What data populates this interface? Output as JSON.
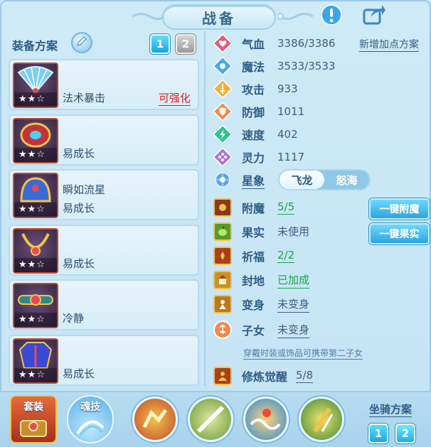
{
  "title": "战备",
  "top_icons": {
    "info": "exclamation-icon",
    "share": "share-icon"
  },
  "left": {
    "section_label": "装备方案",
    "plans": [
      "1",
      "2"
    ],
    "active_plan": 0,
    "equipment": [
      {
        "name": "",
        "attr": "法术暴击",
        "stars": "★★☆",
        "upgrade": "可强化",
        "icon": "fan-icon"
      },
      {
        "name": "",
        "attr": "易成长",
        "stars": "★★☆",
        "upgrade": "",
        "icon": "gem-icon"
      },
      {
        "name": "瞬如流星",
        "attr": "易成长",
        "stars": "★★☆",
        "upgrade": "",
        "icon": "helmet-icon"
      },
      {
        "name": "",
        "attr": "易成长",
        "stars": "★★☆",
        "upgrade": "",
        "icon": "necklace-icon"
      },
      {
        "name": "",
        "attr": "冷静",
        "stars": "★★☆",
        "upgrade": "",
        "icon": "belt-icon"
      },
      {
        "name": "",
        "attr": "易成长",
        "stars": "★★☆",
        "upgrade": "",
        "icon": "armor-icon"
      }
    ]
  },
  "stats": {
    "add_points": "新增加点方案",
    "items": [
      {
        "name": "气血",
        "value": "3386/3386",
        "color": "#e85a7a",
        "icon": "heart-icon"
      },
      {
        "name": "魔法",
        "value": "3533/3533",
        "color": "#4aa8f0",
        "icon": "mana-icon"
      },
      {
        "name": "攻击",
        "value": "933",
        "color": "#f2b13a",
        "icon": "sword-icon"
      },
      {
        "name": "防御",
        "value": "1011",
        "color": "#f08a4a",
        "icon": "shield-icon"
      },
      {
        "name": "速度",
        "value": "402",
        "color": "#2ec48a",
        "icon": "speed-icon"
      },
      {
        "name": "灵力",
        "value": "1117",
        "color": "#b071e0",
        "icon": "spirit-icon"
      }
    ],
    "star_phase": {
      "label": "星象",
      "options": [
        "飞龙",
        "怒海"
      ],
      "selected": 0
    }
  },
  "enhancements": [
    {
      "name": "附魔",
      "value": "5/5",
      "style": "green",
      "icon": "enchant-icon"
    },
    {
      "name": "果实",
      "value": "未使用",
      "style": "gray",
      "icon": "fruit-icon"
    },
    {
      "name": "祈福",
      "value": "2/2",
      "style": "green",
      "icon": "bless-icon"
    },
    {
      "name": "封地",
      "value": "已加成",
      "style": "green",
      "icon": "fief-icon"
    },
    {
      "name": "变身",
      "value": "未变身",
      "style": "ul",
      "icon": "transform-icon"
    },
    {
      "name": "子女",
      "value": "未变身",
      "style": "ul",
      "icon": "child-icon"
    }
  ],
  "one_key_enchant": "一键附魔",
  "one_key_fruit": "一键果实",
  "hint": "穿戴时装或饰品可携带第二子女",
  "cultivation": {
    "name": "修炼觉醒",
    "value": "5/8"
  },
  "bottom": {
    "suit_label": "套装",
    "soul_label": "魂技",
    "mount_label": "坐骑方案",
    "mount_plans": [
      "1",
      "2"
    ],
    "active_mount": 1
  }
}
